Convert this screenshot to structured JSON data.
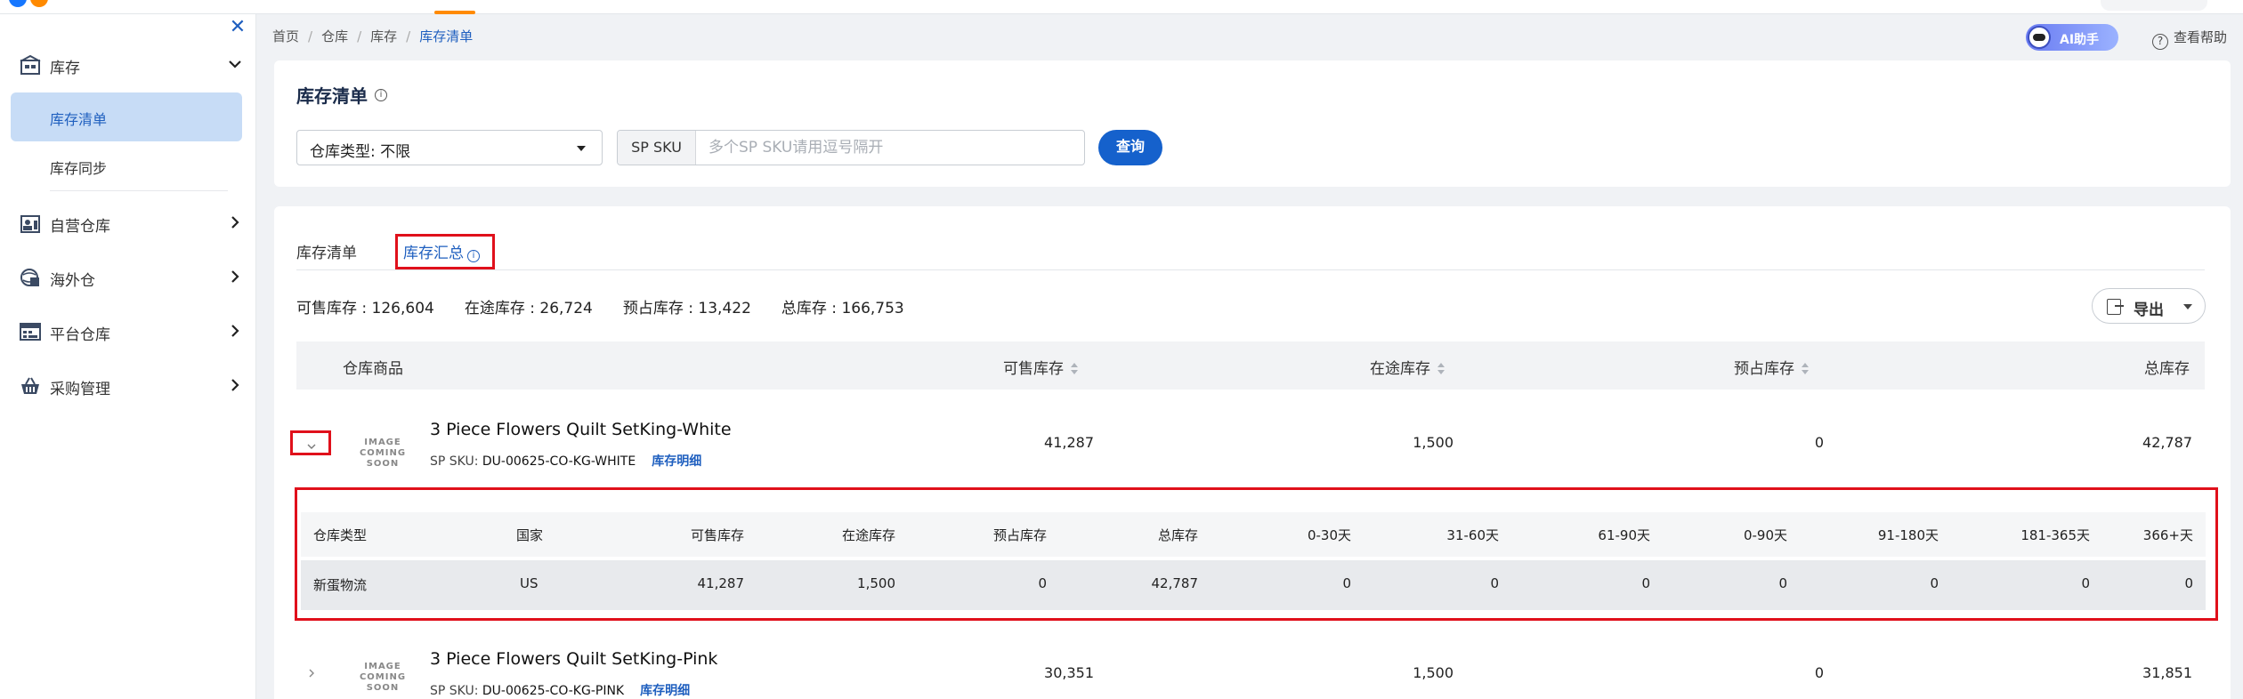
{
  "sidebar": {
    "groups": [
      {
        "label": "库存",
        "expanded": true,
        "icon": "warehouse-icon"
      },
      {
        "label": "自营仓库",
        "icon": "self-warehouse-icon"
      },
      {
        "label": "海外仓",
        "icon": "overseas-warehouse-icon"
      },
      {
        "label": "平台仓库",
        "icon": "platform-warehouse-icon"
      },
      {
        "label": "采购管理",
        "icon": "purchase-icon"
      }
    ],
    "subitems": [
      {
        "label": "库存清单",
        "active": true
      },
      {
        "label": "库存同步",
        "active": false
      }
    ]
  },
  "breadcrumb": [
    "首页",
    "仓库",
    "库存",
    "库存清单"
  ],
  "header": {
    "ai_label": "AI助手",
    "help_label": "查看帮助"
  },
  "page": {
    "title": "库存清单"
  },
  "filters": {
    "warehouse_type": "仓库类型: 不限",
    "sku_addon": "SP SKU",
    "sku_placeholder": "多个SP SKU请用逗号隔开",
    "query_label": "查询"
  },
  "tabs": [
    {
      "label": "库存清单",
      "active": false
    },
    {
      "label": "库存汇总",
      "active": true
    }
  ],
  "summary": {
    "sellable": "可售库存 : 126,604",
    "in_transit": "在途库存 : 26,724",
    "reserved": "预占库存 : 13,422",
    "total": "总库存 : 166,753"
  },
  "export_label": "导出",
  "table": {
    "headers": [
      "仓库商品",
      "可售库存",
      "在途库存",
      "预占库存",
      "总库存"
    ],
    "rows": [
      {
        "image_text": [
          "IMAGE",
          "COMING SOON"
        ],
        "name": "3 Piece Flowers Quilt SetKing-White",
        "sku_prefix": "SP SKU: ",
        "sku": "DU-00625-CO-KG-WHITE",
        "detail_link": "库存明细",
        "sellable": "41,287",
        "in_transit": "1,500",
        "reserved": "0",
        "total": "42,787",
        "expanded": true
      },
      {
        "image_text": [
          "IMAGE",
          "COMING SOON"
        ],
        "name": "3 Piece Flowers Quilt SetKing-Pink",
        "sku_prefix": "SP SKU: ",
        "sku": "DU-00625-CO-KG-PINK",
        "detail_link": "库存明细",
        "sellable": "30,351",
        "in_transit": "1,500",
        "reserved": "0",
        "total": "31,851",
        "expanded": false
      }
    ]
  },
  "detail": {
    "headers": [
      "仓库类型",
      "国家",
      "可售库存",
      "在途库存",
      "预占库存",
      "总库存",
      "0-30天",
      "31-60天",
      "61-90天",
      "0-90天",
      "91-180天",
      "181-365天",
      "366+天"
    ],
    "row": [
      "新蛋物流",
      "US",
      "41,287",
      "1,500",
      "0",
      "42,787",
      "0",
      "0",
      "0",
      "0",
      "0",
      "0",
      "0"
    ]
  },
  "colors": {
    "accent": "#1561cc",
    "highlight": "#e0101b",
    "active_bg": "#c7dcf6"
  }
}
